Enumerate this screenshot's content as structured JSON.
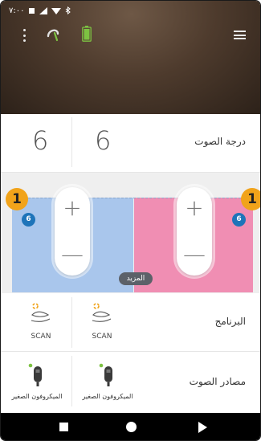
{
  "statusbar": {
    "time": "٧:٠٠"
  },
  "volume": {
    "label": "درجة الصوت",
    "left_value": "6",
    "right_value": "6"
  },
  "adjust": {
    "left_badge": "1",
    "right_badge": "1",
    "left_level": "6",
    "right_level": "6",
    "plus_symbol": "+",
    "minus_symbol": "—",
    "more_label": "المزيد"
  },
  "program": {
    "label": "البرنامج",
    "left_name": "SCAN",
    "right_name": "SCAN"
  },
  "sources": {
    "label": "مصادر الصوت",
    "left_name": "الميكروفون الصغير",
    "right_name": "الميكروفون الصغير"
  },
  "colors": {
    "left_ear": "#a9c6ec",
    "right_ear": "#f08eb3",
    "badge_orange": "#f1a31a",
    "badge_blue": "#1e74b9",
    "battery_green": "#7dc242"
  },
  "icons": {
    "header": [
      "menu-dots-icon",
      "hearing-aid-icon",
      "battery-icon",
      "hamburger-menu-icon"
    ],
    "program": "scan-program-icon",
    "source": "microphone-icon",
    "nav": [
      "recents-square-icon",
      "home-circle-icon",
      "back-triangle-icon"
    ]
  }
}
